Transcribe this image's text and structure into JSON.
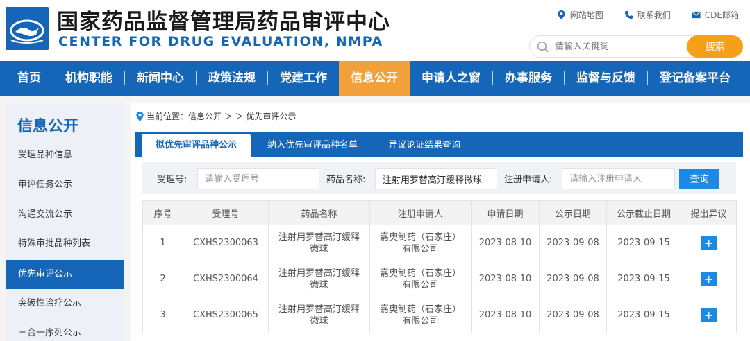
{
  "header": {
    "title_cn": "国家药品监督管理局药品审评中心",
    "title_en": "CENTER FOR DRUG EVALUATION, NMPA",
    "logo_icon": "cde-logo-icon",
    "links": [
      {
        "label": "网站地图",
        "icon": "map-pin-icon"
      },
      {
        "label": "联系我们",
        "icon": "phone-icon"
      },
      {
        "label": "CDE邮箱",
        "icon": "mail-icon"
      }
    ],
    "search": {
      "placeholder": "请输入关键词",
      "button": "搜索",
      "icon": "search-icon"
    }
  },
  "nav": {
    "items": [
      "首页",
      "机构职能",
      "新闻中心",
      "政策法规",
      "党建工作",
      "信息公开",
      "申请人之窗",
      "办事服务",
      "监督与反馈",
      "登记备案平台"
    ],
    "active": "信息公开"
  },
  "sidebar": {
    "title": "信息公开",
    "items": [
      "受理品种信息",
      "审评任务公示",
      "沟通交流公示",
      "特殊审批品种列表",
      "优先审评公示",
      "突破性治疗公示",
      "三合一序列公示"
    ],
    "active": "优先审评公示"
  },
  "breadcrumb": {
    "text": "当前位置：信息公开 ＞ ＞ 优先审评公示",
    "icon": "location-icon"
  },
  "tabs": [
    "拟优先审评品种公示",
    "纳入优先审评品种名单",
    "异议论证结果查询"
  ],
  "filter": {
    "acceptance_label": "受理号:",
    "acceptance_placeholder": "请输入受理号",
    "drug_label": "药品名称:",
    "drug_value": "注射用罗替高汀缓释微球",
    "applicant_label": "注册申请人:",
    "applicant_placeholder": "请输入注册申请人",
    "query_button": "查询"
  },
  "table": {
    "columns": [
      "序号",
      "受理号",
      "药品名称",
      "注册申请人",
      "申请日期",
      "公示日期",
      "公示截止日期",
      "提出异议"
    ],
    "rows": [
      {
        "no": "1",
        "acceptance": "CXHS2300063",
        "drug_l1": "注射用罗替高汀缓释",
        "drug_l2": "微球",
        "applicant_l1": "嘉奥制药（石家庄）",
        "applicant_l2": "有限公司",
        "apply_date": "2023-08-10",
        "publish_date": "2023-09-08",
        "deadline": "2023-09-15",
        "action": "+"
      },
      {
        "no": "2",
        "acceptance": "CXHS2300064",
        "drug_l1": "注射用罗替高汀缓释",
        "drug_l2": "微球",
        "applicant_l1": "嘉奥制药（石家庄）",
        "applicant_l2": "有限公司",
        "apply_date": "2023-08-10",
        "publish_date": "2023-09-08",
        "deadline": "2023-09-15",
        "action": "+"
      },
      {
        "no": "3",
        "acceptance": "CXHS2300065",
        "drug_l1": "注射用罗替高汀缓释",
        "drug_l2": "微球",
        "applicant_l1": "嘉奥制药（石家庄）",
        "applicant_l2": "有限公司",
        "apply_date": "2023-08-10",
        "publish_date": "2023-09-08",
        "deadline": "2023-09-15",
        "action": "+"
      }
    ]
  },
  "colors": {
    "brand_blue": "#1565b8",
    "accent_orange": "#f2a03a",
    "search_orange": "#f6a01a",
    "button_blue": "#1e88e5"
  }
}
